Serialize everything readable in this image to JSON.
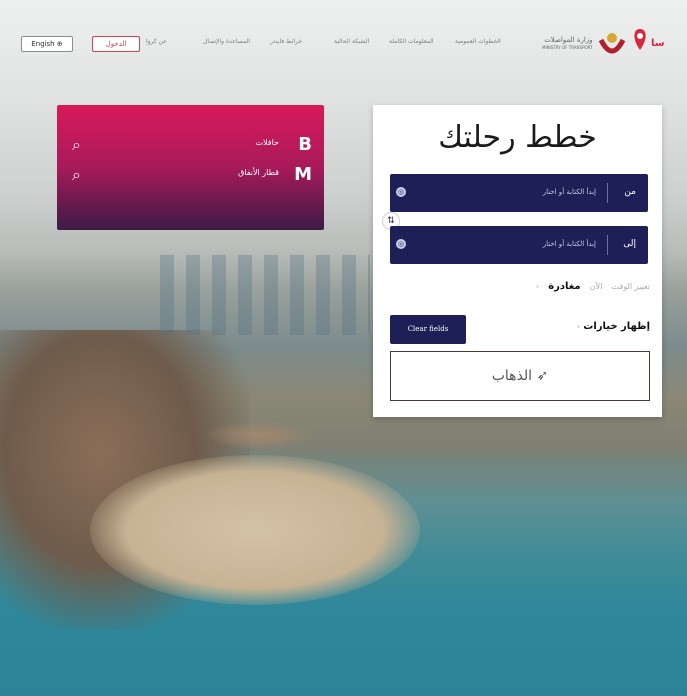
{
  "header": {
    "language_button": "Engish",
    "login_button": "الدخول",
    "nav_links": [
      "عن كروا",
      "المساعدة والإتصال",
      "خرائط فايندر",
      "الشبكة الحالية",
      "المعلومات الكاملة",
      "الخطوات العمومية"
    ],
    "logo_text_1": "وزارة المواصلات",
    "logo_text_2": "MINISTRY OF TRANSPORT"
  },
  "quick_panel": {
    "items": [
      {
        "label": "حافلات",
        "icon_letter": "B",
        "icon": "bus-icon"
      },
      {
        "label": "قطار الأنفاق",
        "icon_letter": "M",
        "icon": "metro-icon"
      }
    ]
  },
  "planner": {
    "title": "خطط رحلتك",
    "from_label": "من",
    "to_label": "إلى",
    "from_placeholder": "إبدأ الكتابة أو اختار",
    "to_placeholder": "إبدأ الكتابة أو اختار",
    "depart_label": "مغادرة",
    "depart_now": "الآن",
    "depart_change": "تغيير الوقت",
    "show_options": "إظهار خيارات",
    "clear_button": "Clear fields",
    "go_button": "الذهاب"
  },
  "colors": {
    "panel_navy": "#1d1f56",
    "quick_gradient_top": "#d9195a",
    "quick_gradient_bottom": "#3c1b46"
  }
}
